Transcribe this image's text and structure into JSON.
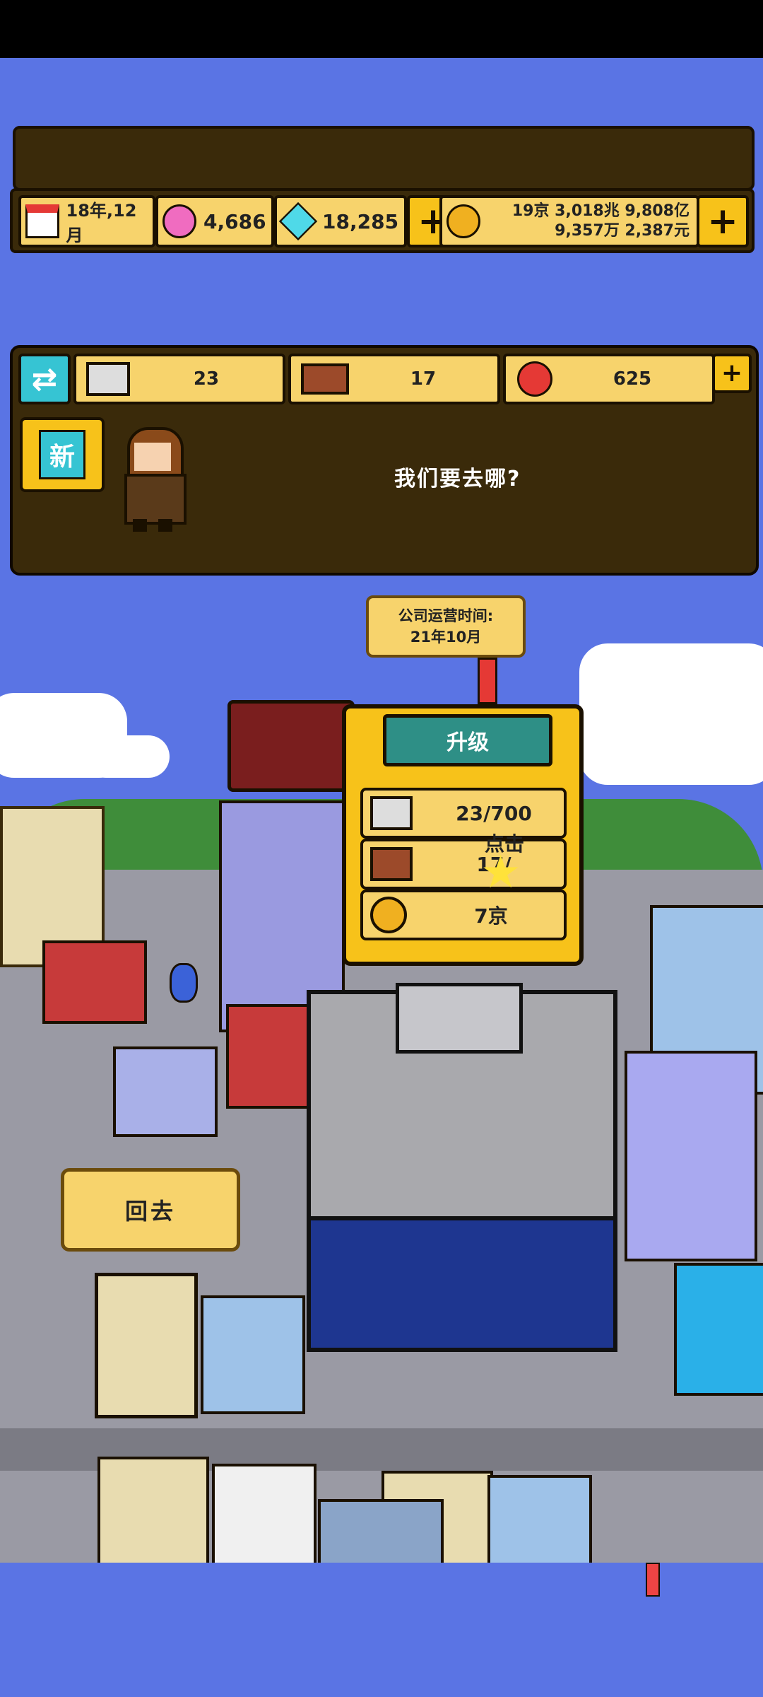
{
  "header": {
    "date": "18年,12月",
    "pink_gems": "4,686",
    "blue_gems": "18,285",
    "money_line1": "19京 3,018兆 9,808亿",
    "money_line2": "9,357万 2,387元"
  },
  "resources": {
    "steel": "23",
    "bricks": "17",
    "food": "625"
  },
  "dialog": {
    "new_label": "新",
    "speech": "我们要去哪?"
  },
  "tooltip": {
    "line1": "公司运营时间:",
    "line2": "21年10月"
  },
  "upgrade": {
    "title": "升级",
    "steel_req": "23/700",
    "brick_req": "17/",
    "coin_req": "7京",
    "tap_hint": "点击"
  },
  "back_label": "回去",
  "colors": {
    "background": "#5a74e4",
    "panel": "#3a2a0a",
    "yellow": "#f7d36c",
    "accent": "#f7c21a",
    "teal": "#36c4d3"
  },
  "icons": [
    "calendar-icon",
    "pink-gem-icon",
    "blue-gem-icon",
    "plus-icon",
    "coin-icon",
    "swap-icon",
    "steel-beam-icon",
    "brick-icon",
    "apple-icon",
    "star-icon"
  ]
}
